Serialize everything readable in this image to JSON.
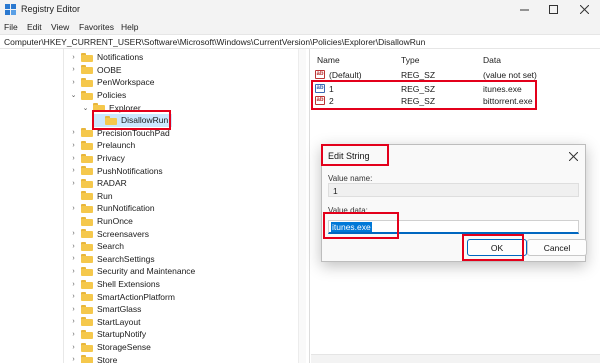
{
  "window": {
    "title": "Registry Editor"
  },
  "menu": [
    "File",
    "Edit",
    "View",
    "Favorites",
    "Help"
  ],
  "address": "Computer\\HKEY_CURRENT_USER\\Software\\Microsoft\\Windows\\CurrentVersion\\Policies\\Explorer\\DisallowRun",
  "tree": [
    {
      "label": "Notifications",
      "arrow": "›"
    },
    {
      "label": "OOBE",
      "arrow": "›"
    },
    {
      "label": "PenWorkspace",
      "arrow": "›"
    },
    {
      "label": "Policies",
      "arrow": "⌄"
    },
    {
      "label": "Explorer",
      "arrow": "⌄"
    },
    {
      "label": "DisallowRun",
      "arrow": ""
    },
    {
      "label": "PrecisionTouchPad",
      "arrow": "›"
    },
    {
      "label": "Prelaunch",
      "arrow": "›"
    },
    {
      "label": "Privacy",
      "arrow": "›"
    },
    {
      "label": "PushNotifications",
      "arrow": "›"
    },
    {
      "label": "RADAR",
      "arrow": "›"
    },
    {
      "label": "Run",
      "arrow": ""
    },
    {
      "label": "RunNotification",
      "arrow": "›"
    },
    {
      "label": "RunOnce",
      "arrow": ""
    },
    {
      "label": "Screensavers",
      "arrow": "›"
    },
    {
      "label": "Search",
      "arrow": "›"
    },
    {
      "label": "SearchSettings",
      "arrow": "›"
    },
    {
      "label": "Security and Maintenance",
      "arrow": "›"
    },
    {
      "label": "Shell Extensions",
      "arrow": "›"
    },
    {
      "label": "SmartActionPlatform",
      "arrow": "›"
    },
    {
      "label": "SmartGlass",
      "arrow": "›"
    },
    {
      "label": "StartLayout",
      "arrow": "›"
    },
    {
      "label": "StartupNotify",
      "arrow": "›"
    },
    {
      "label": "StorageSense",
      "arrow": "›"
    },
    {
      "label": "Store",
      "arrow": "›"
    }
  ],
  "values": {
    "headers": {
      "name": "Name",
      "type": "Type",
      "data": "Data"
    },
    "rows": [
      {
        "name": "(Default)",
        "type": "REG_SZ",
        "data": "(value not set)"
      },
      {
        "name": "1",
        "type": "REG_SZ",
        "data": "itunes.exe"
      },
      {
        "name": "2",
        "type": "REG_SZ",
        "data": "bittorrent.exe"
      }
    ]
  },
  "dialog": {
    "title": "Edit String",
    "value_name_label": "Value name:",
    "value_name": "1",
    "value_data_label": "Value data:",
    "value_data": "itunes.exe",
    "ok_label": "OK",
    "cancel_label": "Cancel"
  },
  "colors": {
    "annotation": "#e3001b",
    "selection": "#0078d7",
    "folder": "#f5c84c"
  }
}
